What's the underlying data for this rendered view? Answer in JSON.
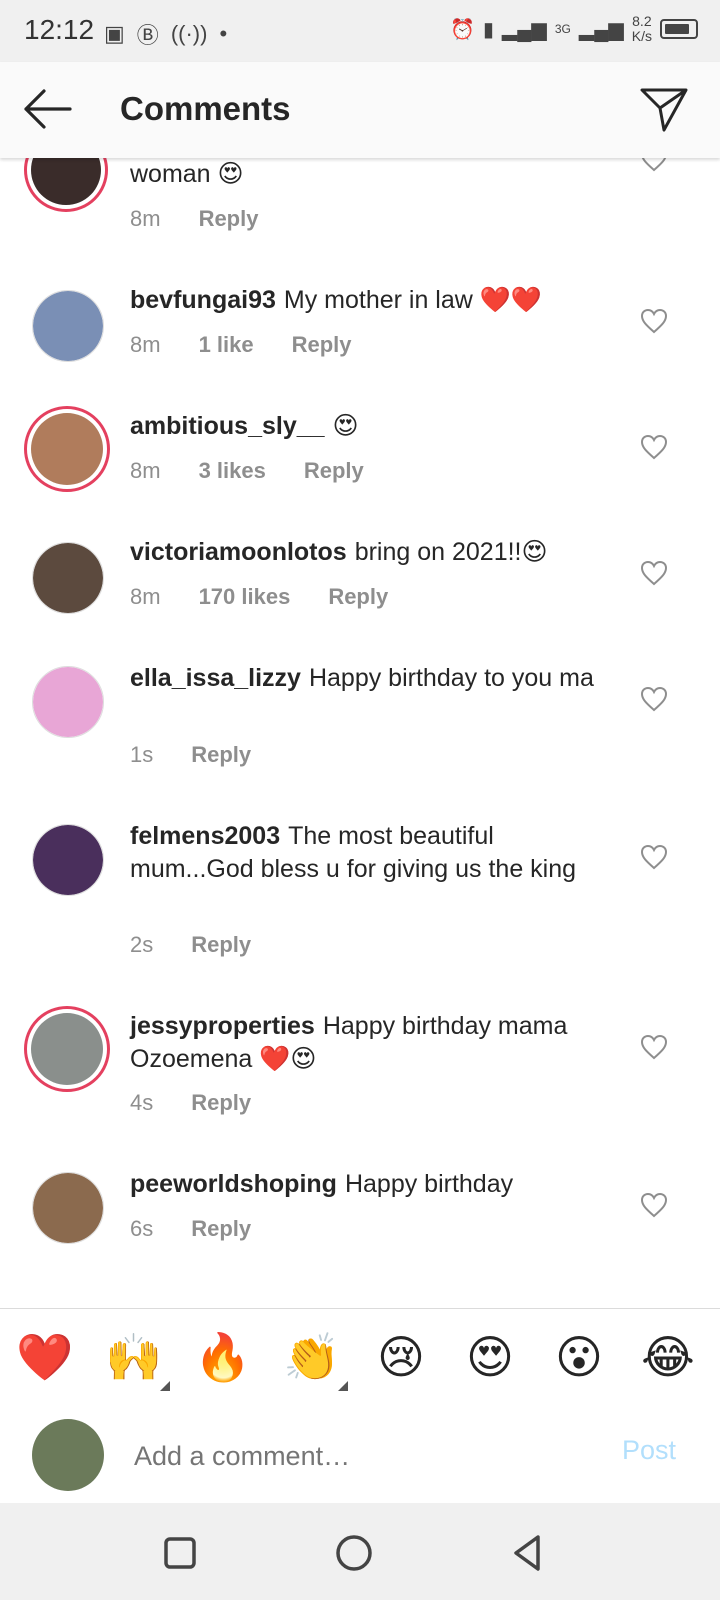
{
  "status_bar": {
    "time": "12:12",
    "network": "3G",
    "speed_value": "8.2",
    "speed_unit": "K/s"
  },
  "header": {
    "title": "Comments"
  },
  "comments": [
    {
      "username": "",
      "text": "woman 😍",
      "time": "8m",
      "likes": "",
      "reply": "Reply",
      "ring": true,
      "avatar_color": "#3a2c2a"
    },
    {
      "username": "bevfungai93",
      "text": "My mother in law ❤️❤️",
      "time": "8m",
      "likes": "1 like",
      "reply": "Reply",
      "ring": false,
      "avatar_color": "#7a8fb5"
    },
    {
      "username": "ambitious_sly__",
      "text": "😍",
      "time": "8m",
      "likes": "3 likes",
      "reply": "Reply",
      "ring": true,
      "avatar_color": "#b07c5c"
    },
    {
      "username": "victoriamoonlotos",
      "text": "bring on 2021!!😍",
      "time": "8m",
      "likes": "170 likes",
      "reply": "Reply",
      "ring": false,
      "avatar_color": "#5c4a3e"
    },
    {
      "username": "ella_issa_lizzy",
      "text": "Happy birthday to you ma",
      "time": "1s",
      "likes": "",
      "reply": "Reply",
      "ring": false,
      "avatar_color": "#e8a6d6"
    },
    {
      "username": "felmens2003",
      "text": "The most beautiful mum...God bless u for giving us the king",
      "time": "2s",
      "likes": "",
      "reply": "Reply",
      "ring": false,
      "avatar_color": "#4a2f5c"
    },
    {
      "username": "jessyproperties",
      "text": "Happy birthday mama Ozoemena ❤️😍",
      "time": "4s",
      "likes": "",
      "reply": "Reply",
      "ring": true,
      "avatar_color": "#8a8f8c"
    },
    {
      "username": "peeworldshoping",
      "text": "Happy birthday",
      "time": "6s",
      "likes": "",
      "reply": "Reply",
      "ring": false,
      "avatar_color": "#8b6a4e"
    }
  ],
  "emoji_bar": {
    "emojis": [
      "❤️",
      "🙌",
      "🔥",
      "👏",
      "😢",
      "😍",
      "😮",
      "😂"
    ]
  },
  "composer": {
    "placeholder": "Add a comment…",
    "post_label": "Post"
  }
}
